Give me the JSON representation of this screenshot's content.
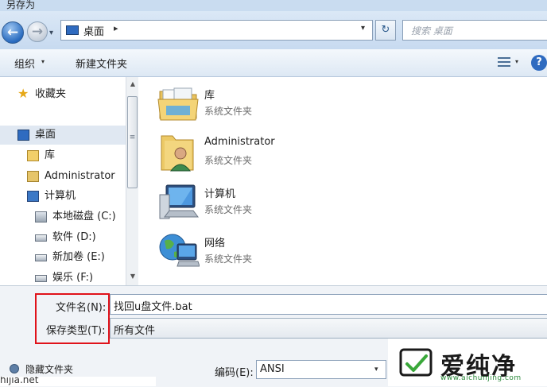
{
  "window": {
    "title": "另存为"
  },
  "address": {
    "location": "桌面",
    "separator": "▸",
    "dropdown": "▾",
    "history": "▾"
  },
  "search": {
    "placeholder": "搜索 桌面"
  },
  "toolbar": {
    "organize": "组织",
    "organize_arrow": "▾",
    "new_folder": "新建文件夹",
    "view_arrow": "▾",
    "help": "?"
  },
  "sidebar": {
    "items": [
      {
        "label": "收藏夹",
        "icon": "star-icon"
      },
      {
        "label": "桌面",
        "icon": "desktop-icon"
      },
      {
        "label": "库",
        "icon": "library-icon"
      },
      {
        "label": "Administrator",
        "icon": "user-icon"
      },
      {
        "label": "计算机",
        "icon": "computer-icon"
      },
      {
        "label": "本地磁盘 (C:)",
        "icon": "system-drive-icon"
      },
      {
        "label": "软件 (D:)",
        "icon": "drive-icon"
      },
      {
        "label": "新加卷 (E:)",
        "icon": "drive-icon"
      },
      {
        "label": "娱乐 (F:)",
        "icon": "drive-icon"
      }
    ]
  },
  "files": [
    {
      "name": "库",
      "type": "系统文件夹",
      "icon": "library-folder-icon"
    },
    {
      "name": "Administrator",
      "type": "系统文件夹",
      "icon": "user-folder-icon"
    },
    {
      "name": "计算机",
      "type": "系统文件夹",
      "icon": "computer-icon"
    },
    {
      "name": "网络",
      "type": "系统文件夹",
      "icon": "network-icon"
    }
  ],
  "form": {
    "filename_label": "文件名(N):",
    "filename_value": "找回u盘文件.bat",
    "savetype_label": "保存类型(T):",
    "savetype_value": "所有文件",
    "hide_folders_label": "隐藏文件夹",
    "encoding_label": "编码(E):",
    "encoding_value": "ANSI",
    "encoding_arrow": "▾"
  },
  "watermark": {
    "title": "爱纯净",
    "url": "www.aichunjing.com",
    "corner_text": "hijia.net"
  },
  "colors": {
    "highlight": "#e0121a",
    "accent": "#2f6bc0"
  }
}
